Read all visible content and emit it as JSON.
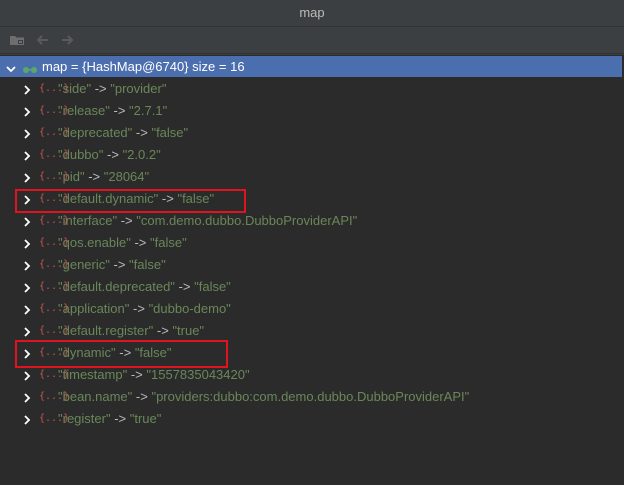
{
  "window": {
    "title": "map"
  },
  "toolbar": {
    "icons": [
      "folder-icon",
      "back-arrow-icon",
      "forward-arrow-icon"
    ]
  },
  "root": {
    "label": "map = {HashMap@6740}  size = 16"
  },
  "entries": [
    {
      "key": "\"side\"",
      "value": "\"provider\""
    },
    {
      "key": "\"release\"",
      "value": "\"2.7.1\""
    },
    {
      "key": "\"deprecated\"",
      "value": "\"false\""
    },
    {
      "key": "\"dubbo\"",
      "value": "\"2.0.2\""
    },
    {
      "key": "\"pid\"",
      "value": "\"28064\""
    },
    {
      "key": "\"default.dynamic\"",
      "value": "\"false\""
    },
    {
      "key": "\"interface\"",
      "value": "\"com.demo.dubbo.DubboProviderAPI\""
    },
    {
      "key": "\"qos.enable\"",
      "value": "\"false\""
    },
    {
      "key": "\"generic\"",
      "value": "\"false\""
    },
    {
      "key": "\"default.deprecated\"",
      "value": "\"false\""
    },
    {
      "key": "\"application\"",
      "value": "\"dubbo-demo\""
    },
    {
      "key": "\"default.register\"",
      "value": "\"true\""
    },
    {
      "key": "\"dynamic\"",
      "value": "\"false\""
    },
    {
      "key": "\"timestamp\"",
      "value": "\"1557835043420\""
    },
    {
      "key": "\"bean.name\"",
      "value": "\"providers:dubbo:com.demo.dubbo.DubboProviderAPI\""
    },
    {
      "key": "\"register\"",
      "value": "\"true\""
    }
  ],
  "arrow_text": "->",
  "icon_text": "{...}",
  "colors": {
    "selection": "#4b6eaf",
    "string_value": "#6a8759",
    "object_icon": "#c75450",
    "highlight_box": "#e0141e"
  }
}
